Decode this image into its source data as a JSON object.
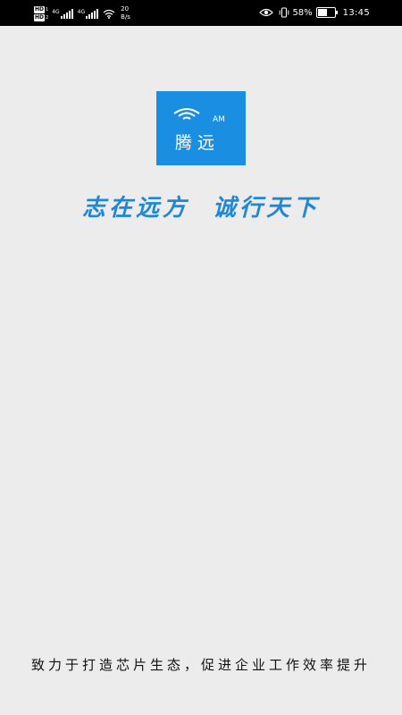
{
  "status_bar": {
    "sim1_badge": "HD",
    "sim1_sub": "1",
    "sim2_badge": "HD",
    "sim2_sub": "2",
    "sim1_network": "4G",
    "sim2_network": "4G",
    "speed_value": "20",
    "speed_unit": "B/s",
    "battery_percent_text": "58%",
    "battery_level": 0.58,
    "time": "13:45",
    "icons": [
      "hd-icon",
      "signal-icon",
      "wifi-icon",
      "eye-icon",
      "vibrate-icon",
      "battery-icon"
    ]
  },
  "splash": {
    "logo_am": "AM",
    "logo_name": "腾远",
    "slogan": "志在远方  诚行天下",
    "tagline": "致力于打造芯片生态，促进企业工作效率提升",
    "colors": {
      "background": "#ececec",
      "logo_bg": "#1a8ee0",
      "slogan": "#1e87d6",
      "tagline": "#111111",
      "status_bar": "#000000"
    }
  }
}
